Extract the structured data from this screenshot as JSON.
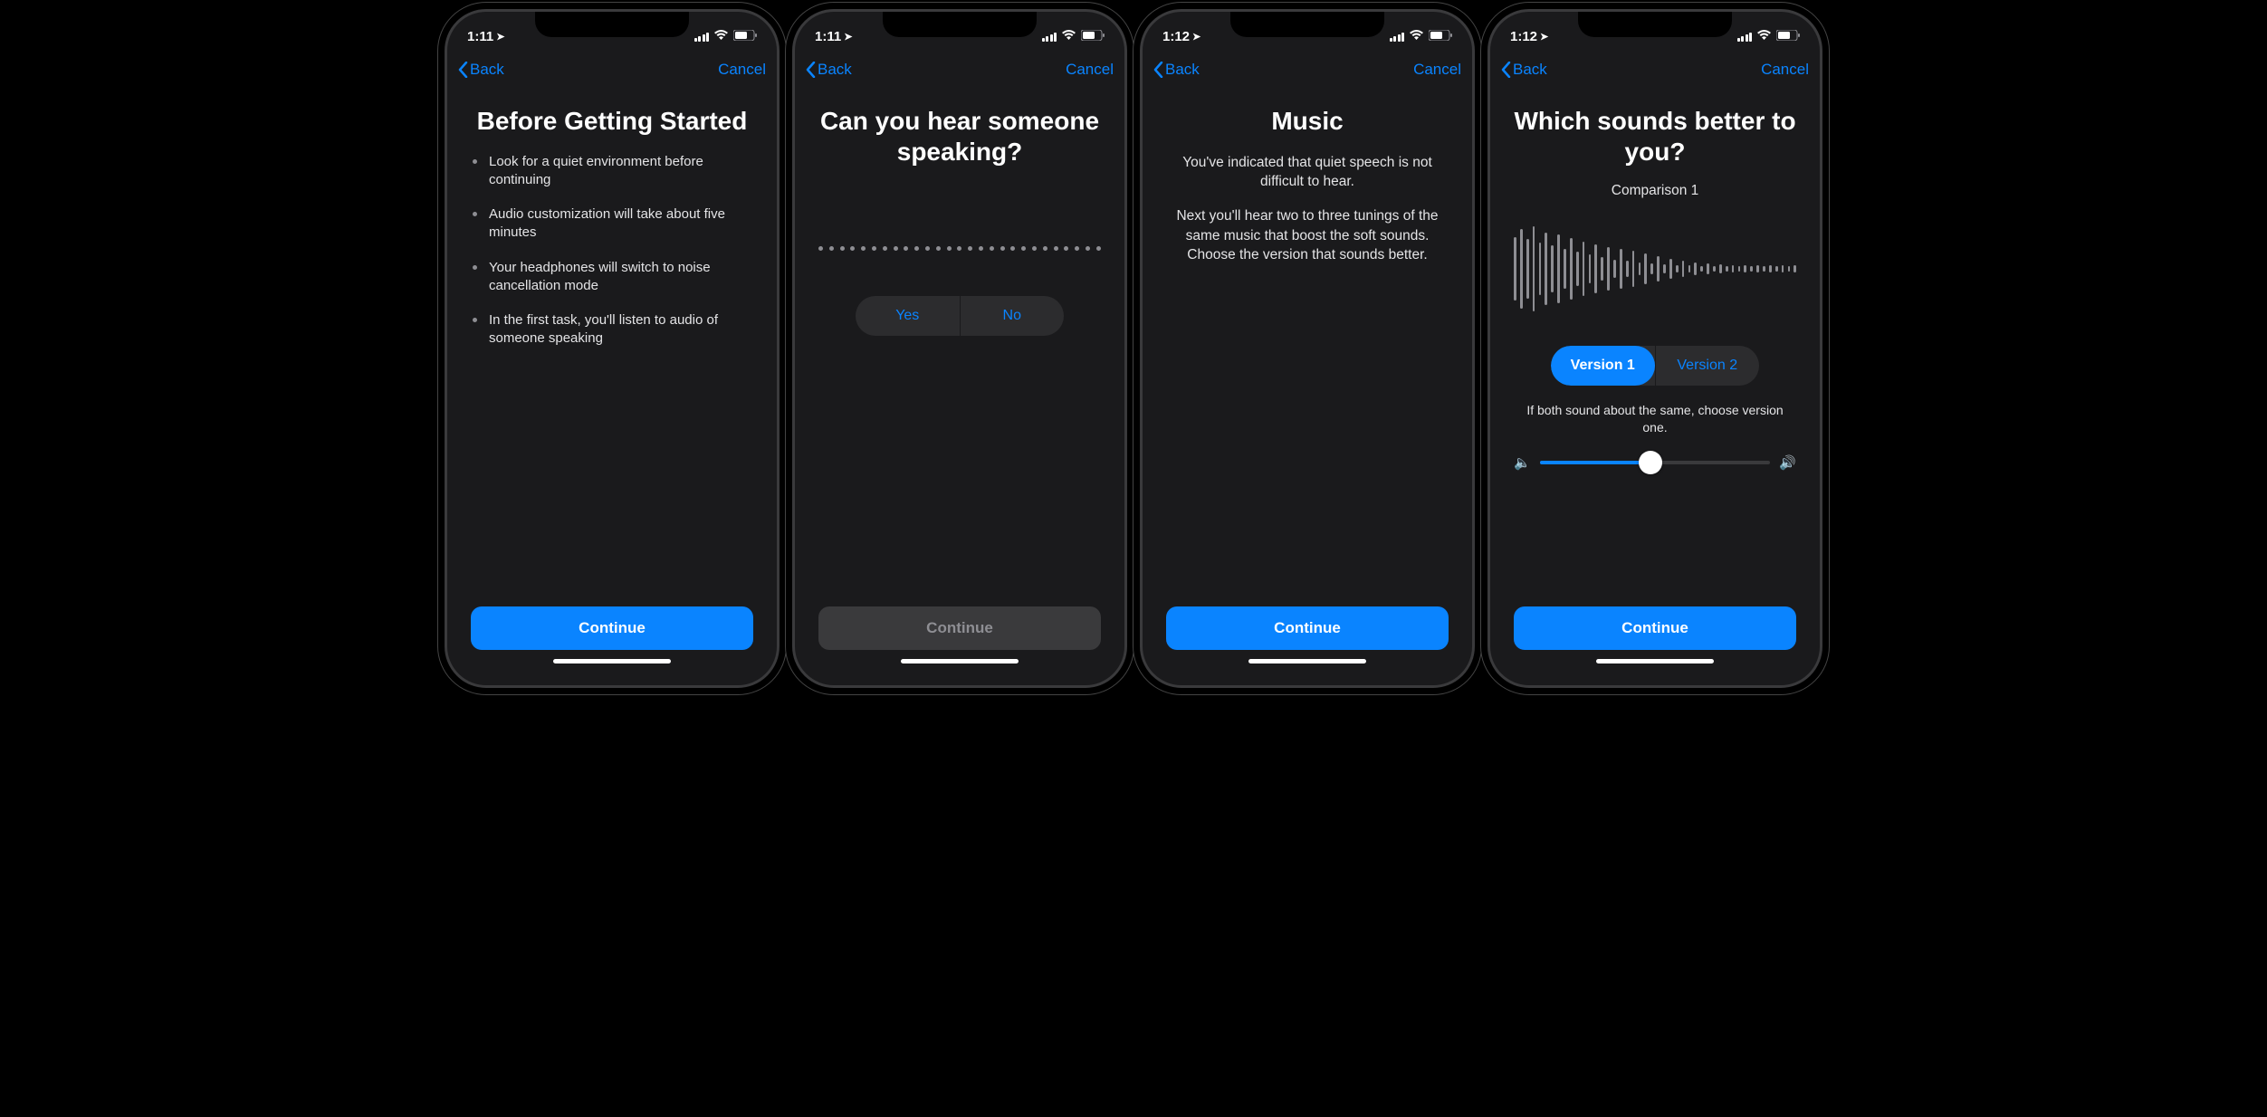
{
  "status": {
    "times": [
      "1:11",
      "1:11",
      "1:12",
      "1:12"
    ]
  },
  "nav": {
    "back": "Back",
    "cancel": "Cancel"
  },
  "buttons": {
    "continue": "Continue",
    "yes": "Yes",
    "no": "No"
  },
  "screen1": {
    "title": "Before Getting Started",
    "bullets": [
      "Look for a quiet environment before continuing",
      "Audio customization will take about five minutes",
      "Your headphones will switch to noise cancellation mode",
      "In the first task, you'll listen to audio of someone speaking"
    ]
  },
  "screen2": {
    "title": "Can you hear someone speaking?"
  },
  "screen3": {
    "title": "Music",
    "p1": "You've indicated that quiet speech is not difficult to hear.",
    "p2": "Next you'll hear two to three tunings of the same music that boost the soft sounds. Choose the version that sounds better."
  },
  "screen4": {
    "title": "Which sounds better to you?",
    "comparison": "Comparison 1",
    "v1": "Version 1",
    "v2": "Version 2",
    "hint": "If both sound about the same, choose version one."
  }
}
